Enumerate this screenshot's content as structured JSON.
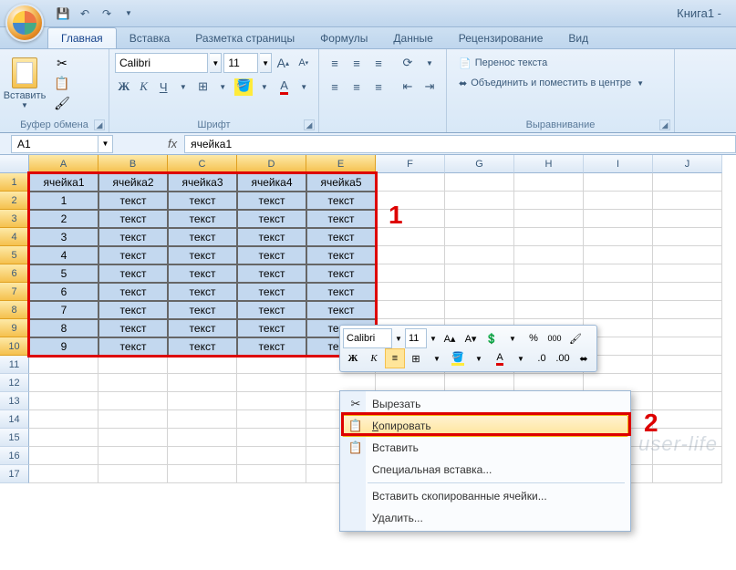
{
  "title": "Книга1 -",
  "tabs": [
    "Главная",
    "Вставка",
    "Разметка страницы",
    "Формулы",
    "Данные",
    "Рецензирование",
    "Вид"
  ],
  "active_tab": 0,
  "clipboard": {
    "paste": "Вставить",
    "group": "Буфер обмена"
  },
  "font": {
    "name": "Calibri",
    "size": "11",
    "group": "Шрифт",
    "bold": "Ж",
    "italic": "К",
    "underline": "Ч"
  },
  "alignment": {
    "group": "Выравнивание",
    "wrap": "Перенос текста",
    "merge": "Объединить и поместить в центре"
  },
  "name_box": "A1",
  "fx": "fx",
  "formula": "ячейка1",
  "columns": [
    "A",
    "B",
    "C",
    "D",
    "E",
    "F",
    "G",
    "H",
    "I",
    "J"
  ],
  "rows": [
    1,
    2,
    3,
    4,
    5,
    6,
    7,
    8,
    9,
    10,
    11,
    12,
    13,
    14,
    15,
    16,
    17
  ],
  "data": {
    "headers": [
      "ячейка1",
      "ячейка2",
      "ячейка3",
      "ячейка4",
      "ячейка5"
    ],
    "body": [
      [
        "1",
        "текст",
        "текст",
        "текст",
        "текст"
      ],
      [
        "2",
        "текст",
        "текст",
        "текст",
        "текст"
      ],
      [
        "3",
        "текст",
        "текст",
        "текст",
        "текст"
      ],
      [
        "4",
        "текст",
        "текст",
        "текст",
        "текст"
      ],
      [
        "5",
        "текст",
        "текст",
        "текст",
        "текст"
      ],
      [
        "6",
        "текст",
        "текст",
        "текст",
        "текст"
      ],
      [
        "7",
        "текст",
        "текст",
        "текст",
        "текст"
      ],
      [
        "8",
        "текст",
        "текст",
        "текст",
        "текст"
      ],
      [
        "9",
        "текст",
        "текст",
        "текст",
        "текст"
      ]
    ]
  },
  "mini": {
    "font": "Calibri",
    "size": "11",
    "pct": "%",
    "zeros": "000",
    "bold": "Ж",
    "italic": "К"
  },
  "ctx": {
    "cut": "Вырезать",
    "copy": "Копировать",
    "paste": "Вставить",
    "paste_special": "Специальная вставка...",
    "insert_copied": "Вставить скопированные ячейки...",
    "delete": "Удалить..."
  },
  "annot": {
    "one": "1",
    "two": "2"
  }
}
